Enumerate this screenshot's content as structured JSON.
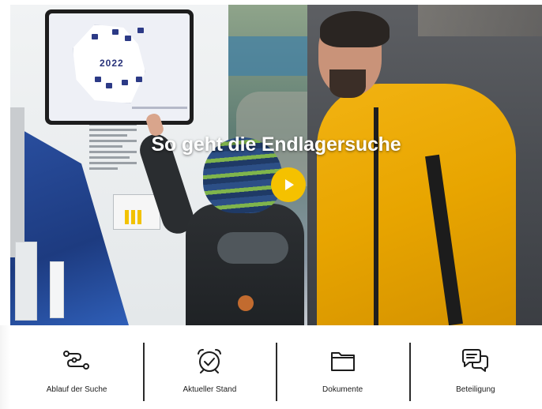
{
  "hero": {
    "title": "So geht die Endlagersuche",
    "screen_year": "2022"
  },
  "nav": {
    "items": [
      {
        "label": "Ablauf der Suche",
        "icon": "route-icon"
      },
      {
        "label": "Aktueller Stand",
        "icon": "alarm-clock-check-icon"
      },
      {
        "label": "Dokumente",
        "icon": "folder-icon"
      },
      {
        "label": "Beteiligung",
        "icon": "chat-bubbles-icon"
      }
    ]
  },
  "colors": {
    "accent": "#f5c100",
    "text": "#1c1c1c",
    "divider": "#2a2a2a"
  }
}
